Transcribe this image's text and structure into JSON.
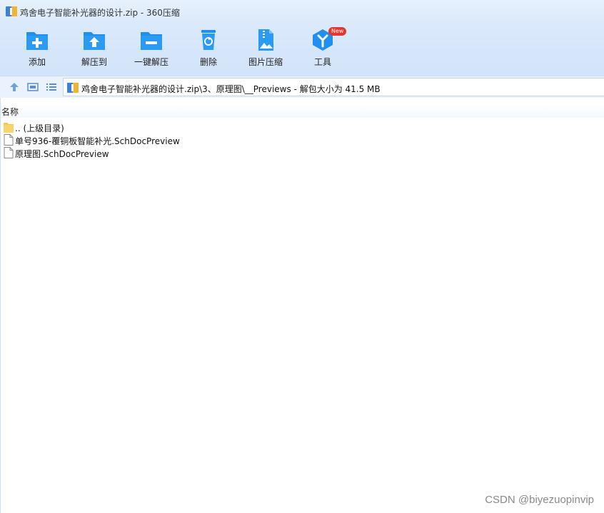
{
  "window": {
    "title": "鸡舍电子智能补光器的设计.zip - 360压缩"
  },
  "toolbar": {
    "items": [
      {
        "label": "添加",
        "icon": "add-folder-icon"
      },
      {
        "label": "解压到",
        "icon": "extract-to-icon"
      },
      {
        "label": "一键解压",
        "icon": "one-click-extract-icon"
      },
      {
        "label": "删除",
        "icon": "trash-icon"
      },
      {
        "label": "图片压缩",
        "icon": "image-compress-icon"
      },
      {
        "label": "工具",
        "icon": "tools-icon",
        "badge": "New"
      }
    ]
  },
  "navigation": {
    "address": "鸡舍电子智能补光器的设计.zip\\3、原理图\\__Previews - 解包大小为 41.5 MB"
  },
  "file_list": {
    "column_name": "名称",
    "rows": [
      {
        "name": ".. (上级目录)",
        "type": "parent-folder"
      },
      {
        "name": "单号936-覆铜板智能补光.SchDocPreview",
        "type": "file"
      },
      {
        "name": "原理图.SchDocPreview",
        "type": "file"
      }
    ]
  },
  "watermark": "CSDN @biyezuopinvip",
  "colors": {
    "accent": "#1f8ff0",
    "titlebar": "#e7f1fd",
    "badge": "#e8342f"
  }
}
